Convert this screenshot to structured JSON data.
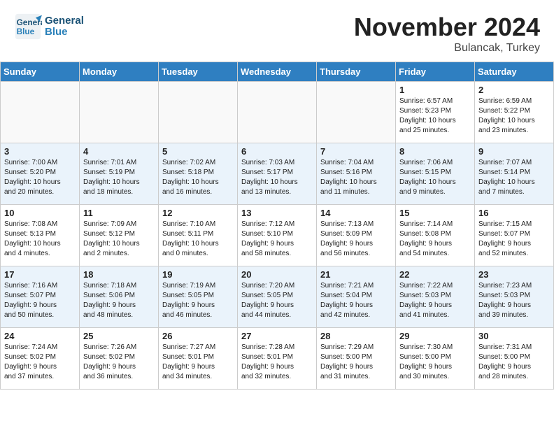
{
  "header": {
    "logo_line1": "General",
    "logo_line2": "Blue",
    "month": "November 2024",
    "location": "Bulancak, Turkey"
  },
  "weekdays": [
    "Sunday",
    "Monday",
    "Tuesday",
    "Wednesday",
    "Thursday",
    "Friday",
    "Saturday"
  ],
  "weeks": [
    [
      {
        "day": "",
        "info": ""
      },
      {
        "day": "",
        "info": ""
      },
      {
        "day": "",
        "info": ""
      },
      {
        "day": "",
        "info": ""
      },
      {
        "day": "",
        "info": ""
      },
      {
        "day": "1",
        "info": "Sunrise: 6:57 AM\nSunset: 5:23 PM\nDaylight: 10 hours\nand 25 minutes."
      },
      {
        "day": "2",
        "info": "Sunrise: 6:59 AM\nSunset: 5:22 PM\nDaylight: 10 hours\nand 23 minutes."
      }
    ],
    [
      {
        "day": "3",
        "info": "Sunrise: 7:00 AM\nSunset: 5:20 PM\nDaylight: 10 hours\nand 20 minutes."
      },
      {
        "day": "4",
        "info": "Sunrise: 7:01 AM\nSunset: 5:19 PM\nDaylight: 10 hours\nand 18 minutes."
      },
      {
        "day": "5",
        "info": "Sunrise: 7:02 AM\nSunset: 5:18 PM\nDaylight: 10 hours\nand 16 minutes."
      },
      {
        "day": "6",
        "info": "Sunrise: 7:03 AM\nSunset: 5:17 PM\nDaylight: 10 hours\nand 13 minutes."
      },
      {
        "day": "7",
        "info": "Sunrise: 7:04 AM\nSunset: 5:16 PM\nDaylight: 10 hours\nand 11 minutes."
      },
      {
        "day": "8",
        "info": "Sunrise: 7:06 AM\nSunset: 5:15 PM\nDaylight: 10 hours\nand 9 minutes."
      },
      {
        "day": "9",
        "info": "Sunrise: 7:07 AM\nSunset: 5:14 PM\nDaylight: 10 hours\nand 7 minutes."
      }
    ],
    [
      {
        "day": "10",
        "info": "Sunrise: 7:08 AM\nSunset: 5:13 PM\nDaylight: 10 hours\nand 4 minutes."
      },
      {
        "day": "11",
        "info": "Sunrise: 7:09 AM\nSunset: 5:12 PM\nDaylight: 10 hours\nand 2 minutes."
      },
      {
        "day": "12",
        "info": "Sunrise: 7:10 AM\nSunset: 5:11 PM\nDaylight: 10 hours\nand 0 minutes."
      },
      {
        "day": "13",
        "info": "Sunrise: 7:12 AM\nSunset: 5:10 PM\nDaylight: 9 hours\nand 58 minutes."
      },
      {
        "day": "14",
        "info": "Sunrise: 7:13 AM\nSunset: 5:09 PM\nDaylight: 9 hours\nand 56 minutes."
      },
      {
        "day": "15",
        "info": "Sunrise: 7:14 AM\nSunset: 5:08 PM\nDaylight: 9 hours\nand 54 minutes."
      },
      {
        "day": "16",
        "info": "Sunrise: 7:15 AM\nSunset: 5:07 PM\nDaylight: 9 hours\nand 52 minutes."
      }
    ],
    [
      {
        "day": "17",
        "info": "Sunrise: 7:16 AM\nSunset: 5:07 PM\nDaylight: 9 hours\nand 50 minutes."
      },
      {
        "day": "18",
        "info": "Sunrise: 7:18 AM\nSunset: 5:06 PM\nDaylight: 9 hours\nand 48 minutes."
      },
      {
        "day": "19",
        "info": "Sunrise: 7:19 AM\nSunset: 5:05 PM\nDaylight: 9 hours\nand 46 minutes."
      },
      {
        "day": "20",
        "info": "Sunrise: 7:20 AM\nSunset: 5:05 PM\nDaylight: 9 hours\nand 44 minutes."
      },
      {
        "day": "21",
        "info": "Sunrise: 7:21 AM\nSunset: 5:04 PM\nDaylight: 9 hours\nand 42 minutes."
      },
      {
        "day": "22",
        "info": "Sunrise: 7:22 AM\nSunset: 5:03 PM\nDaylight: 9 hours\nand 41 minutes."
      },
      {
        "day": "23",
        "info": "Sunrise: 7:23 AM\nSunset: 5:03 PM\nDaylight: 9 hours\nand 39 minutes."
      }
    ],
    [
      {
        "day": "24",
        "info": "Sunrise: 7:24 AM\nSunset: 5:02 PM\nDaylight: 9 hours\nand 37 minutes."
      },
      {
        "day": "25",
        "info": "Sunrise: 7:26 AM\nSunset: 5:02 PM\nDaylight: 9 hours\nand 36 minutes."
      },
      {
        "day": "26",
        "info": "Sunrise: 7:27 AM\nSunset: 5:01 PM\nDaylight: 9 hours\nand 34 minutes."
      },
      {
        "day": "27",
        "info": "Sunrise: 7:28 AM\nSunset: 5:01 PM\nDaylight: 9 hours\nand 32 minutes."
      },
      {
        "day": "28",
        "info": "Sunrise: 7:29 AM\nSunset: 5:00 PM\nDaylight: 9 hours\nand 31 minutes."
      },
      {
        "day": "29",
        "info": "Sunrise: 7:30 AM\nSunset: 5:00 PM\nDaylight: 9 hours\nand 30 minutes."
      },
      {
        "day": "30",
        "info": "Sunrise: 7:31 AM\nSunset: 5:00 PM\nDaylight: 9 hours\nand 28 minutes."
      }
    ]
  ]
}
